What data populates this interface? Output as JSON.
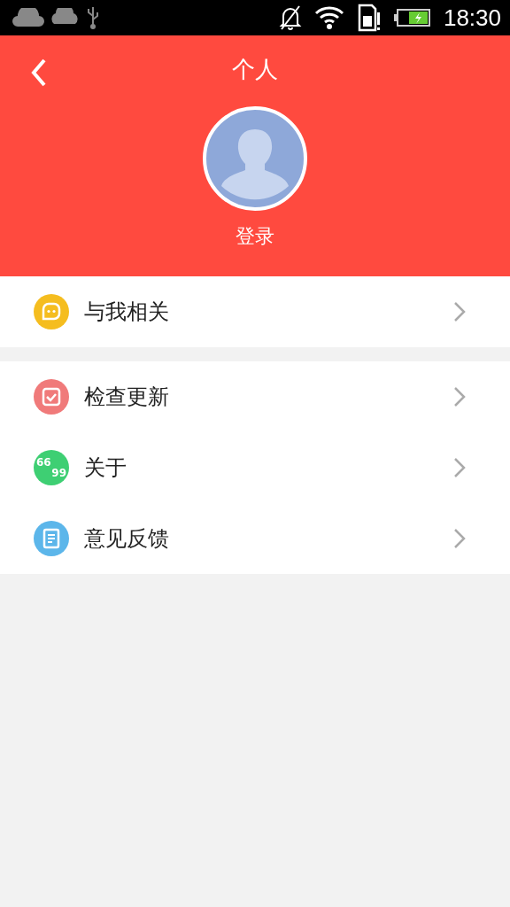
{
  "status_bar": {
    "time": "18:30"
  },
  "header": {
    "title": "个人",
    "login": "登录"
  },
  "sections": [
    {
      "items": [
        {
          "kind": "mention",
          "label": "与我相关"
        }
      ]
    },
    {
      "items": [
        {
          "kind": "update",
          "label": "检查更新"
        },
        {
          "kind": "about",
          "label": "关于",
          "icon_lines": [
            "66",
            "99"
          ]
        },
        {
          "kind": "feedback",
          "label": "意见反馈"
        }
      ]
    }
  ]
}
